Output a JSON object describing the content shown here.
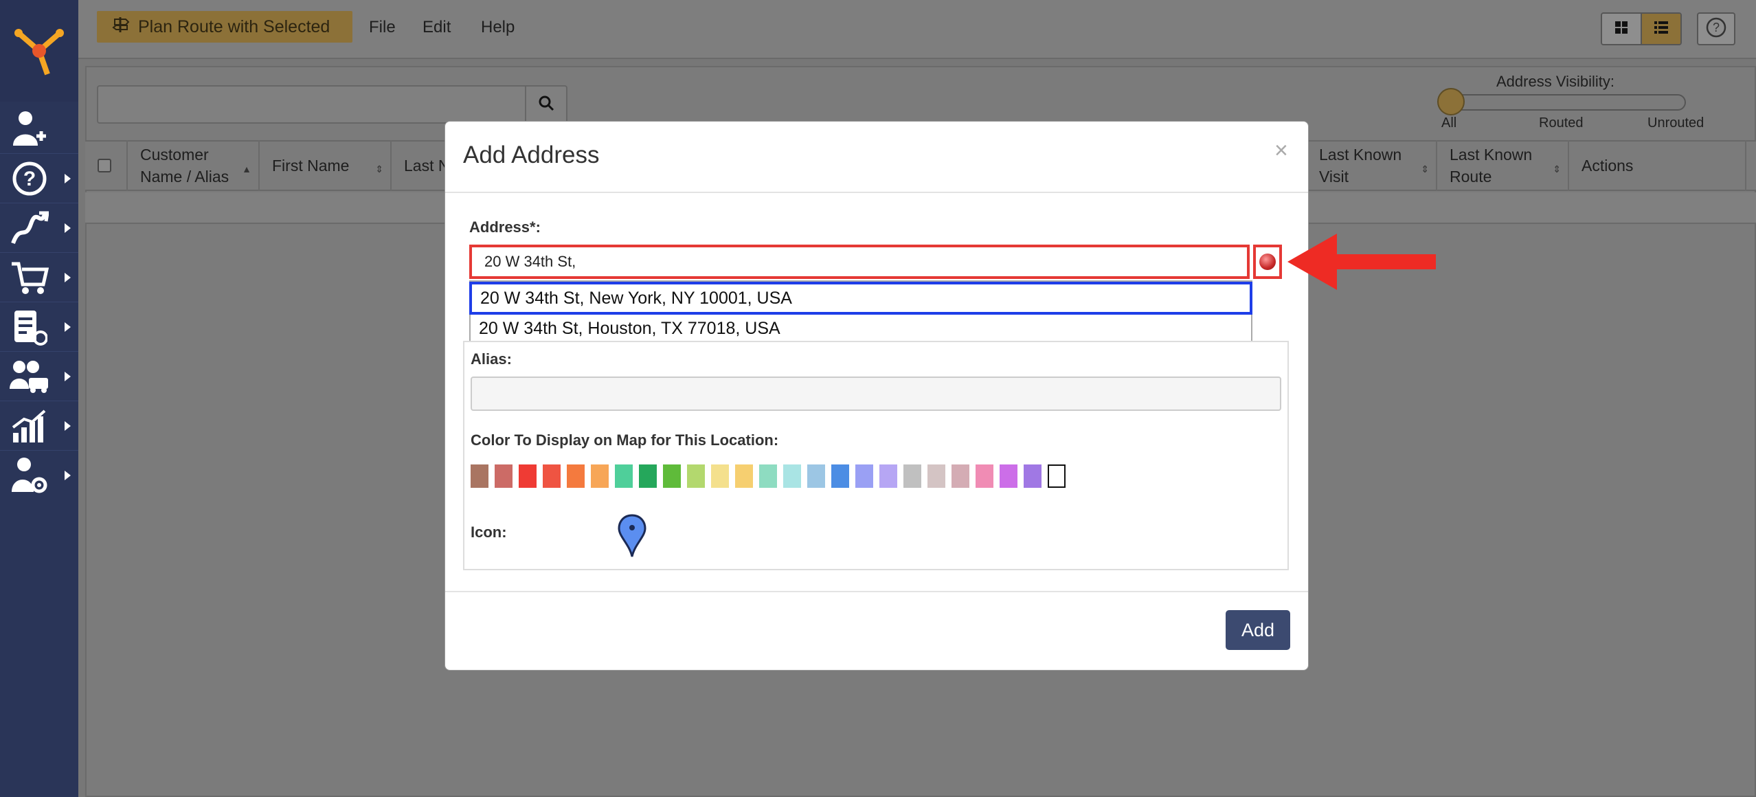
{
  "toolbar": {
    "plan_route_label": "Plan Route with Selected",
    "menu": [
      "File",
      "Edit",
      "Help"
    ]
  },
  "visibility": {
    "label": "Address Visibility:",
    "options": [
      "All",
      "Routed",
      "Unrouted"
    ],
    "selected": "All"
  },
  "table": {
    "columns": [
      "Customer Name / Alias",
      "First Name",
      "Last N",
      "Last Known Visit",
      "Last Known Route",
      "Actions"
    ]
  },
  "modal": {
    "title": "Add Address",
    "close": "×",
    "address_label": "Address*:",
    "address_value": "20 W 34th St,",
    "suggestions": [
      "20 W 34th St, New York, NY 10001, USA",
      "20 W 34th St, Houston, TX 77018, USA"
    ],
    "alias_label": "Alias:",
    "alias_value": "",
    "color_label": "Color To Display on Map for This Location:",
    "colors": [
      "#a97562",
      "#cc6b66",
      "#ef3b34",
      "#ef5442",
      "#f47a3e",
      "#f7a657",
      "#4fcf9a",
      "#25a75b",
      "#5fbb3a",
      "#b3d86e",
      "#f4e08d",
      "#f6cf70",
      "#8edcc1",
      "#a9e4e4",
      "#9cc6e4",
      "#4c8de4",
      "#9aa0f4",
      "#b6a6f4",
      "#c0c0c0",
      "#d4c4c4",
      "#d4acb4",
      "#f08cb4",
      "#cc6ee8",
      "#a078e4",
      "#ffffff"
    ],
    "icon_label": "Icon:",
    "add_label": "Add"
  },
  "icons": {
    "sidebar": [
      "add-user-icon",
      "help-icon",
      "routes-icon",
      "cart-icon",
      "orders-icon",
      "team-icon",
      "analytics-icon",
      "settings-user-icon"
    ],
    "pin_color": "#5b8ef0"
  }
}
